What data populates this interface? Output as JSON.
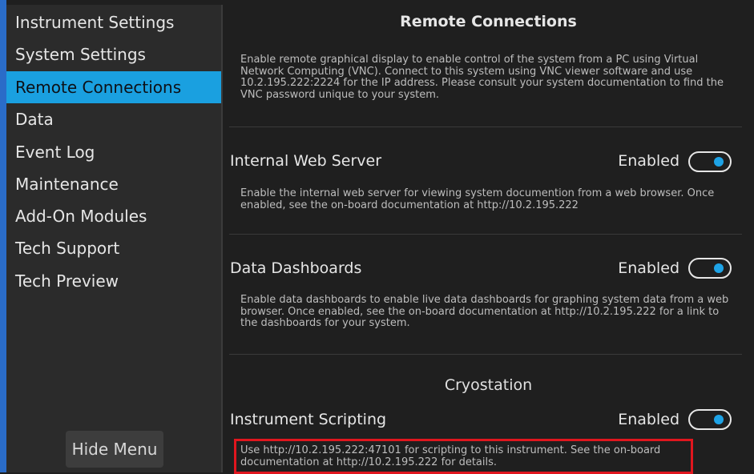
{
  "sidebar": {
    "items": [
      {
        "label": "Instrument Settings"
      },
      {
        "label": "System Settings"
      },
      {
        "label": "Remote Connections"
      },
      {
        "label": "Data"
      },
      {
        "label": "Event Log"
      },
      {
        "label": "Maintenance"
      },
      {
        "label": "Add-On Modules"
      },
      {
        "label": "Tech Support"
      },
      {
        "label": "Tech Preview"
      }
    ],
    "active_item": "Remote Connections",
    "hide_menu_label": "Hide Menu"
  },
  "main": {
    "title": "Remote Connections",
    "vnc_description": "Enable remote graphical display to enable control of the system from a PC using Virtual Network Computing (VNC). Connect to this system using VNC viewer software and use 10.2.195.222:2224 for the IP address.  Please consult your system documentation to find the VNC password unique to your system.",
    "settings": [
      {
        "title": "Internal Web Server",
        "status_label": "Enabled",
        "enabled": true,
        "description": "Enable the internal web server for viewing system documention from a web browser. Once enabled, see the on-board documentation at http://10.2.195.222"
      },
      {
        "title": "Data Dashboards",
        "status_label": "Enabled",
        "enabled": true,
        "description": "Enable data dashboards to enable live data dashboards for graphing system data from a web browser. Once enabled, see the on-board documentation at http://10.2.195.222 for a link to the dashboards for your system."
      }
    ],
    "section_label": "Cryostation",
    "scripting": {
      "title": "Instrument Scripting",
      "status_label": "Enabled",
      "enabled": true,
      "description": "Use http://10.2.195.222:47101 for scripting to this instrument. See the on-board documentation at http://10.2.195.222 for details."
    }
  },
  "colors": {
    "accent": "#1aa0e0",
    "highlight": "#e0161e",
    "background": "#1f1f1f",
    "sidebar_bg": "#2b2b2b"
  }
}
